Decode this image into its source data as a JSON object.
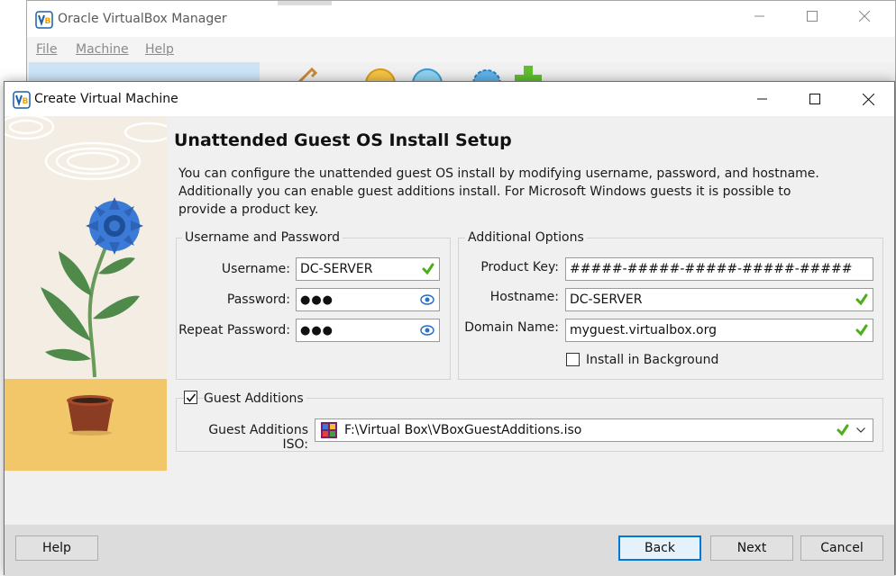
{
  "background_window": {
    "title": "Oracle VirtualBox Manager",
    "menu": [
      "File",
      "Machine",
      "Help"
    ]
  },
  "dialog": {
    "title": "Create Virtual Machine",
    "heading": "Unattended Guest OS Install Setup",
    "description": "You can configure the unattended guest OS install by modifying username, password, and hostname. Additionally you can enable guest additions install. For Microsoft Windows guests it is possible to provide a product key."
  },
  "credentials": {
    "group_title": "Username and Password",
    "username_label": "Username:",
    "username_value": "DC-SERVER",
    "password_label": "Password:",
    "password_value": "●●●",
    "repeat_password_label": "Repeat Password:",
    "repeat_password_value": "●●●"
  },
  "options": {
    "group_title": "Additional Options",
    "product_key_label": "Product Key:",
    "product_key_value": "#####-#####-#####-#####-#####",
    "hostname_label": "Hostname:",
    "hostname_value": "DC-SERVER",
    "domain_label": "Domain Name:",
    "domain_value": "myguest.virtualbox.org",
    "install_background_label": "Install in Background",
    "install_background_checked": false
  },
  "guest_additions": {
    "label": "Guest Additions",
    "checked": true,
    "iso_label": "Guest Additions ISO:",
    "iso_path": "F:\\Virtual Box\\VBoxGuestAdditions.iso"
  },
  "buttons": {
    "help": "Help",
    "back": "Back",
    "next": "Next",
    "cancel": "Cancel"
  },
  "colors": {
    "valid_check": "#4caf1a",
    "focus_border": "#0078d7",
    "eye_icon": "#2a6fc9"
  }
}
